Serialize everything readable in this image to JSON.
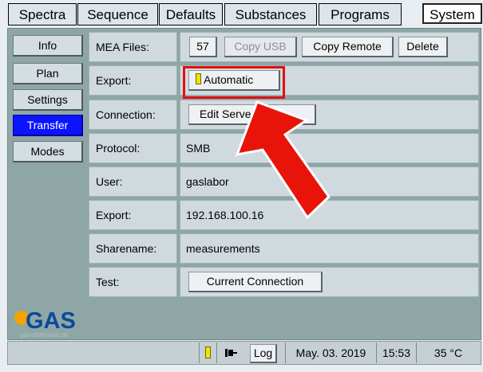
{
  "tabs": [
    {
      "label": "Spectra"
    },
    {
      "label": "Sequence"
    },
    {
      "label": "Defaults"
    },
    {
      "label": "Substances"
    },
    {
      "label": "Programs"
    },
    {
      "label": "System"
    }
  ],
  "sidebar": [
    {
      "label": "Info"
    },
    {
      "label": "Plan"
    },
    {
      "label": "Settings"
    },
    {
      "label": "Transfer"
    },
    {
      "label": "Modes"
    }
  ],
  "rows": {
    "mea_files": {
      "label": "MEA Files:",
      "count": "57",
      "copy_usb": "Copy USB",
      "copy_remote": "Copy Remote",
      "delete": "Delete"
    },
    "export_mode": {
      "label": "Export:",
      "button": "Automatic"
    },
    "connection": {
      "label": "Connection:",
      "button": "Edit Server"
    },
    "protocol": {
      "label": "Protocol:",
      "value": "SMB"
    },
    "user": {
      "label": "User:",
      "value": "gaslabor"
    },
    "export_ip": {
      "label": "Export:",
      "value": "192.168.100.16"
    },
    "sharename": {
      "label": "Sharename:",
      "value": "measurements"
    },
    "test": {
      "label": "Test:",
      "button": "Current Connection"
    }
  },
  "logo": {
    "text": "GAS",
    "url": "gas-dortmund.de"
  },
  "status": {
    "log": "Log",
    "date": "May. 03. 2019",
    "time": "15:53",
    "temp": "35 °C"
  },
  "colors": {
    "active_tab": "#0a14ff",
    "panel": "#8ea6a6",
    "highlight": "#e01010",
    "indicator": "#f5e000"
  }
}
